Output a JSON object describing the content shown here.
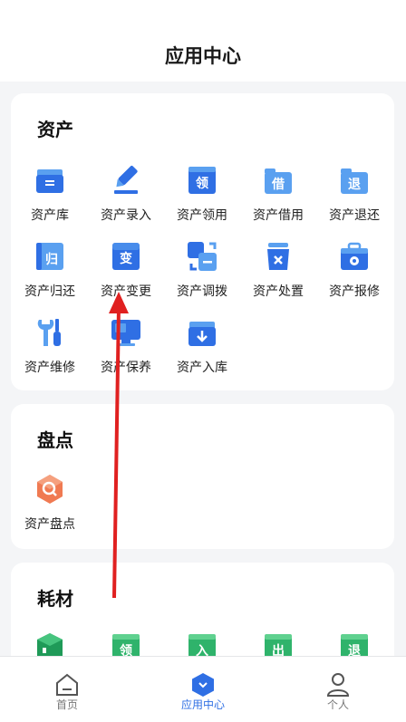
{
  "header": {
    "title": "应用中心"
  },
  "sections": [
    {
      "title": "资产",
      "items": [
        {
          "label": "资产库",
          "icon": "asset-library-icon",
          "glyph": "="
        },
        {
          "label": "资产录入",
          "icon": "asset-entry-pen-icon",
          "glyph": ""
        },
        {
          "label": "资产领用",
          "icon": "asset-requisition-icon",
          "glyph": "领"
        },
        {
          "label": "资产借用",
          "icon": "asset-borrow-icon",
          "glyph": "借"
        },
        {
          "label": "资产退还",
          "icon": "asset-return-icon",
          "glyph": "退"
        },
        {
          "label": "资产归还",
          "icon": "asset-give-back-icon",
          "glyph": "归"
        },
        {
          "label": "资产变更",
          "icon": "asset-change-icon",
          "glyph": "变"
        },
        {
          "label": "资产调拨",
          "icon": "asset-transfer-icon",
          "glyph": "−"
        },
        {
          "label": "资产处置",
          "icon": "asset-disposal-trash-icon",
          "glyph": "×"
        },
        {
          "label": "资产报修",
          "icon": "asset-repair-report-icon",
          "glyph": "⚙"
        },
        {
          "label": "资产维修",
          "icon": "asset-maintenance-tools-icon",
          "glyph": ""
        },
        {
          "label": "资产保养",
          "icon": "asset-upkeep-monitor-icon",
          "glyph": ""
        },
        {
          "label": "资产入库",
          "icon": "asset-inbound-icon",
          "glyph": "↓"
        }
      ]
    },
    {
      "title": "盘点",
      "items": [
        {
          "label": "资产盘点",
          "icon": "asset-inventory-icon",
          "glyph": ""
        }
      ]
    },
    {
      "title": "耗材",
      "items": [
        {
          "label": "",
          "icon": "consumable-box-icon",
          "glyph": ""
        },
        {
          "label": "",
          "icon": "consumable-requisition-icon",
          "glyph": "领"
        },
        {
          "label": "",
          "icon": "consumable-inbound-icon",
          "glyph": "入"
        },
        {
          "label": "",
          "icon": "consumable-outbound-icon",
          "glyph": "出"
        },
        {
          "label": "",
          "icon": "consumable-return-icon",
          "glyph": "退"
        }
      ]
    }
  ],
  "tabbar": {
    "home": {
      "label": "首页"
    },
    "app_center": {
      "label": "应用中心"
    },
    "profile": {
      "label": "个人"
    }
  },
  "colors": {
    "accent": "#2f6fe4",
    "light_blue": "#5aa0f0",
    "green": "#2fb36b",
    "orange": "#f07a52",
    "red_arrow": "#e02020"
  }
}
